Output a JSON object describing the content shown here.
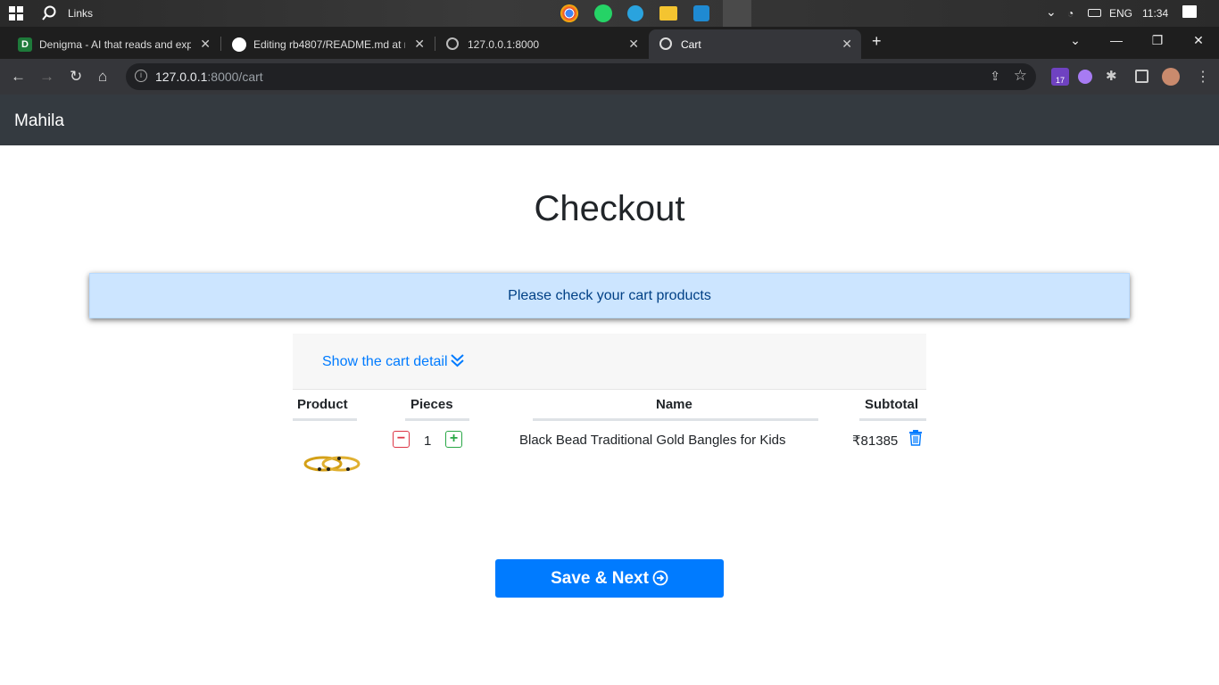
{
  "taskbar": {
    "search_label": "Links",
    "language": "ENG",
    "time": "11:34"
  },
  "browser": {
    "tabs": [
      {
        "title": "Denigma - AI that reads and exp",
        "favicon": "denigma-icon"
      },
      {
        "title": "Editing rb4807/README.md at m",
        "favicon": "github-icon"
      },
      {
        "title": "127.0.0.1:8000",
        "favicon": "globe-icon"
      },
      {
        "title": "Cart",
        "favicon": "globe-icon",
        "active": true
      }
    ],
    "url_host": "127.0.0.1",
    "url_rest": ":8000/cart",
    "extension_badge": "17"
  },
  "navbar": {
    "brand": "Mahila"
  },
  "page": {
    "title": "Checkout",
    "alert_text": "Please check your cart products",
    "cart_toggle": "Show the cart detail",
    "table": {
      "headers": [
        "Product",
        "Pieces",
        "Name",
        "Subtotal"
      ],
      "rows": [
        {
          "image": "gold-bangles-image",
          "quantity": "1",
          "name": "Black Bead Traditional Gold Bangles for Kids",
          "subtotal": "₹81385"
        }
      ]
    },
    "save_button": "Save & Next"
  },
  "colors": {
    "primary": "#007bff",
    "navbar": "#343a40",
    "alert_bg": "#cce5ff",
    "danger": "#dc3545",
    "success": "#28a745"
  }
}
